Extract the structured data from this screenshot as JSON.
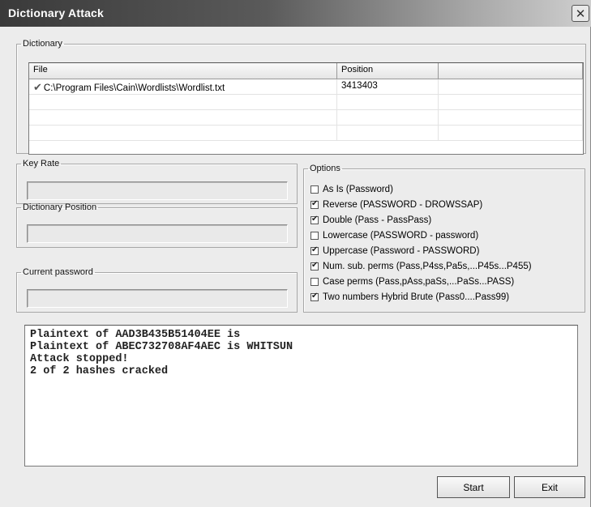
{
  "window": {
    "title": "Dictionary Attack"
  },
  "dictionary": {
    "legend": "Dictionary",
    "columns": [
      "File",
      "Position",
      ""
    ],
    "rows": [
      {
        "file": "C:\\Program Files\\Cain\\Wordlists\\Wordlist.txt",
        "position": "3413403"
      }
    ]
  },
  "key_rate": {
    "legend": "Key Rate",
    "value": ""
  },
  "dictionary_position": {
    "legend": "Dictionary Position",
    "value": ""
  },
  "current_password": {
    "legend": "Current password",
    "value": ""
  },
  "options": {
    "legend": "Options",
    "items": [
      {
        "label": "As Is (Password)",
        "checked": false
      },
      {
        "label": "Reverse (PASSWORD - DROWSSAP)",
        "checked": true
      },
      {
        "label": "Double (Pass - PassPass)",
        "checked": true
      },
      {
        "label": "Lowercase (PASSWORD - password)",
        "checked": false
      },
      {
        "label": "Uppercase (Password - PASSWORD)",
        "checked": true
      },
      {
        "label": "Num. sub. perms (Pass,P4ss,Pa5s,...P45s...P455)",
        "checked": true
      },
      {
        "label": "Case perms (Pass,pAss,paSs,...PaSs...PASS)",
        "checked": false
      },
      {
        "label": "Two numbers Hybrid Brute (Pass0....Pass99)",
        "checked": true
      }
    ]
  },
  "log": {
    "lines": [
      "Plaintext of AAD3B435B51404EE is",
      "Plaintext of ABEC732708AF4AEC is WHITSUN",
      "Attack stopped!",
      "2 of 2 hashes cracked"
    ]
  },
  "buttons": {
    "start": "Start",
    "exit": "Exit"
  }
}
